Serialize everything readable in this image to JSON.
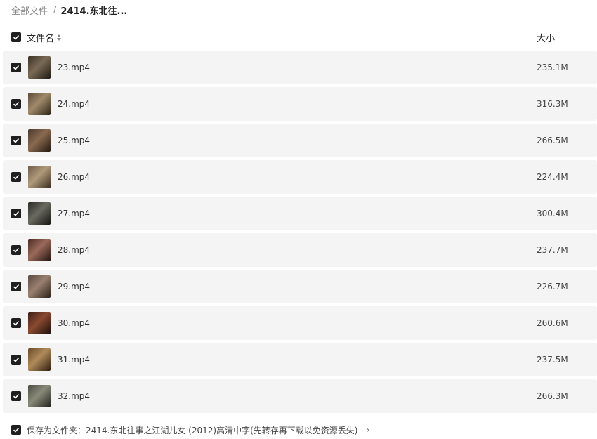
{
  "breadcrumb": {
    "root": "全部文件",
    "separator": "/",
    "current": "2414.东北往..."
  },
  "header": {
    "name_label": "文件名",
    "size_label": "大小",
    "select_all_checked": true
  },
  "files": [
    {
      "name": "23.mp4",
      "size": "235.1M",
      "checked": true,
      "thumb_colors": [
        "#3a3226",
        "#7a6a55",
        "#1e1a14"
      ]
    },
    {
      "name": "24.mp4",
      "size": "316.3M",
      "checked": true,
      "thumb_colors": [
        "#5a4a3a",
        "#a08a6a",
        "#2a2418"
      ]
    },
    {
      "name": "25.mp4",
      "size": "266.5M",
      "checked": true,
      "thumb_colors": [
        "#4a3a2e",
        "#8a6a50",
        "#231a12"
      ]
    },
    {
      "name": "26.mp4",
      "size": "224.4M",
      "checked": true,
      "thumb_colors": [
        "#6a5a48",
        "#b09a7a",
        "#3a2e22"
      ]
    },
    {
      "name": "27.mp4",
      "size": "300.4M",
      "checked": true,
      "thumb_colors": [
        "#2a2a28",
        "#6a6a60",
        "#151512"
      ]
    },
    {
      "name": "28.mp4",
      "size": "237.7M",
      "checked": true,
      "thumb_colors": [
        "#4a2a24",
        "#9a6a5a",
        "#221410"
      ]
    },
    {
      "name": "29.mp4",
      "size": "226.7M",
      "checked": true,
      "thumb_colors": [
        "#5a4a40",
        "#9a8070",
        "#2a221c"
      ]
    },
    {
      "name": "30.mp4",
      "size": "260.6M",
      "checked": true,
      "thumb_colors": [
        "#3a1e18",
        "#8a4a30",
        "#1a0e0a"
      ]
    },
    {
      "name": "31.mp4",
      "size": "237.5M",
      "checked": true,
      "thumb_colors": [
        "#6a4a2a",
        "#b08a5a",
        "#2e1e10"
      ]
    },
    {
      "name": "32.mp4",
      "size": "266.3M",
      "checked": true,
      "thumb_colors": [
        "#4a4a42",
        "#8a8a7a",
        "#22221e"
      ]
    }
  ],
  "footer": {
    "checked": true,
    "save_text": "保存为文件夹：2414.东北往事之江湖儿女 (2012)高清中字(先转存再下载以免资源丢失)",
    "arrow": "›"
  },
  "icons": {
    "checkbox": "checkbox-checked-icon",
    "sort": "sort-icon",
    "thumbnail": "video-thumbnail"
  }
}
